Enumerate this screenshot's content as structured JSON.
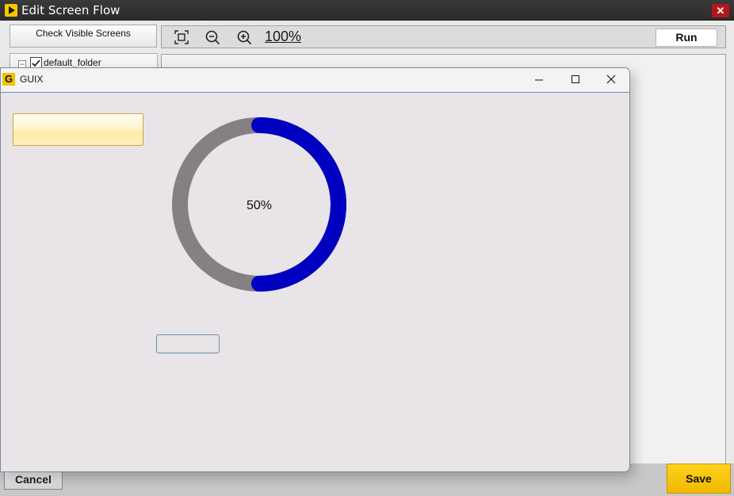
{
  "window": {
    "title": "Edit Screen Flow",
    "close_glyph": "✕"
  },
  "toolbar": {
    "check_label": "Check Visible Screens",
    "zoom_level": "100%",
    "run_label": "Run"
  },
  "tree": {
    "expander_glyph": "−",
    "folder_label": "default_folder",
    "checked": true
  },
  "footer": {
    "cancel_label": "Cancel",
    "save_label": "Save"
  },
  "guix": {
    "icon_letter": "G",
    "title": "GUIX",
    "progress_text": "50%",
    "progress_value": 0.5,
    "colors": {
      "progress": "#0000c0",
      "track": "#848084",
      "background": "#e8e4e8"
    }
  },
  "icons": {
    "fit": "fit-screen-icon",
    "zoom_out": "zoom-out-icon",
    "zoom_in": "zoom-in-icon"
  }
}
